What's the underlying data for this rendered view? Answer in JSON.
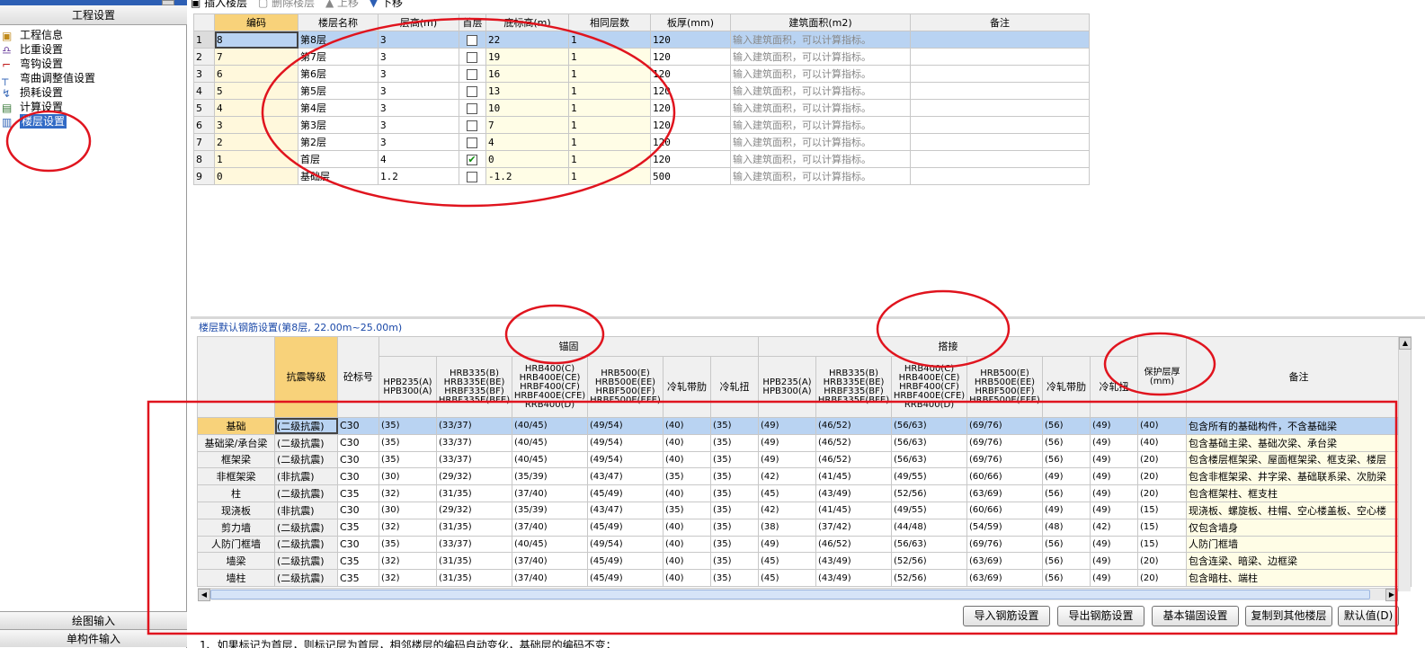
{
  "left_panel": {
    "title": "工程设置",
    "tree": [
      {
        "label": "工程信息",
        "icon": "info-icon"
      },
      {
        "label": "比重设置",
        "icon": "density-icon"
      },
      {
        "label": "弯钩设置",
        "icon": "hook-icon"
      },
      {
        "label": "弯曲调整值设置",
        "icon": "bend-icon"
      },
      {
        "label": "损耗设置",
        "icon": "loss-icon"
      },
      {
        "label": "计算设置",
        "icon": "calc-icon"
      },
      {
        "label": "楼层设置",
        "icon": "floor-icon",
        "selected": true
      }
    ],
    "bottom_buttons": [
      "绘图输入",
      "单构件输入"
    ]
  },
  "toolbar": {
    "insert_floor": "插入楼层",
    "delete_floor": "删除楼层",
    "move_up": "上移",
    "move_down": "下移"
  },
  "floor_table": {
    "headers": [
      "",
      "编码",
      "楼层名称",
      "层高(m)",
      "首层",
      "底标高(m)",
      "相同层数",
      "板厚(mm)",
      "建筑面积(m2)",
      "备注"
    ],
    "rows": [
      {
        "n": "1",
        "code": "8",
        "name": "第8层",
        "height": "3",
        "first": false,
        "elev": "22",
        "same": "1",
        "thick": "120",
        "area": "输入建筑面积，可以计算指标。",
        "note": ""
      },
      {
        "n": "2",
        "code": "7",
        "name": "第7层",
        "height": "3",
        "first": false,
        "elev": "19",
        "same": "1",
        "thick": "120",
        "area": "输入建筑面积，可以计算指标。",
        "note": ""
      },
      {
        "n": "3",
        "code": "6",
        "name": "第6层",
        "height": "3",
        "first": false,
        "elev": "16",
        "same": "1",
        "thick": "120",
        "area": "输入建筑面积，可以计算指标。",
        "note": ""
      },
      {
        "n": "4",
        "code": "5",
        "name": "第5层",
        "height": "3",
        "first": false,
        "elev": "13",
        "same": "1",
        "thick": "120",
        "area": "输入建筑面积，可以计算指标。",
        "note": ""
      },
      {
        "n": "5",
        "code": "4",
        "name": "第4层",
        "height": "3",
        "first": false,
        "elev": "10",
        "same": "1",
        "thick": "120",
        "area": "输入建筑面积，可以计算指标。",
        "note": ""
      },
      {
        "n": "6",
        "code": "3",
        "name": "第3层",
        "height": "3",
        "first": false,
        "elev": "7",
        "same": "1",
        "thick": "120",
        "area": "输入建筑面积，可以计算指标。",
        "note": ""
      },
      {
        "n": "7",
        "code": "2",
        "name": "第2层",
        "height": "3",
        "first": false,
        "elev": "4",
        "same": "1",
        "thick": "120",
        "area": "输入建筑面积，可以计算指标。",
        "note": ""
      },
      {
        "n": "8",
        "code": "1",
        "name": "首层",
        "height": "4",
        "first": true,
        "elev": "0",
        "same": "1",
        "thick": "120",
        "area": "输入建筑面积，可以计算指标。",
        "note": ""
      },
      {
        "n": "9",
        "code": "0",
        "name": "基础层",
        "height": "1.2",
        "first": false,
        "elev": "-1.2",
        "same": "1",
        "thick": "500",
        "area": "输入建筑面积，可以计算指标。",
        "note": ""
      }
    ]
  },
  "rebar": {
    "title": "楼层默认钢筋设置(第8层, 22.00m~25.00m)",
    "headers": {
      "seismic": "抗震等级",
      "concrete": "砼标号",
      "anchor_group": "锚固",
      "lap_group": "搭接",
      "cover": "保护层厚(mm)",
      "note": "备注",
      "sub": [
        "HPB235(A) HPB300(A)",
        "HRB335(B) HRB335E(BE) HRBF335(BF) HRBF335E(BFE)",
        "HRB400(C) HRB400E(CE) HRBF400(CF) HRBF400E(CFE) RRB400(D)",
        "HRB500(E) HRB500E(EE) HRBF500(EF) HRBF500E(EFE)",
        "冷轧带肋",
        "冷轧扭"
      ]
    },
    "rows": [
      {
        "name": "基础",
        "grade": "(二级抗震)",
        "c": "C30",
        "a": [
          "(35)",
          "(33/37)",
          "(40/45)",
          "(49/54)",
          "(40)",
          "(35)"
        ],
        "l": [
          "(49)",
          "(46/52)",
          "(56/63)",
          "(69/76)",
          "(56)",
          "(49)"
        ],
        "cover": "(40)",
        "note": "包含所有的基础构件，不含基础梁"
      },
      {
        "name": "基础梁/承台梁",
        "grade": "(二级抗震)",
        "c": "C30",
        "a": [
          "(35)",
          "(33/37)",
          "(40/45)",
          "(49/54)",
          "(40)",
          "(35)"
        ],
        "l": [
          "(49)",
          "(46/52)",
          "(56/63)",
          "(69/76)",
          "(56)",
          "(49)"
        ],
        "cover": "(40)",
        "note": "包含基础主梁、基础次梁、承台梁"
      },
      {
        "name": "框架梁",
        "grade": "(二级抗震)",
        "c": "C30",
        "a": [
          "(35)",
          "(33/37)",
          "(40/45)",
          "(49/54)",
          "(40)",
          "(35)"
        ],
        "l": [
          "(49)",
          "(46/52)",
          "(56/63)",
          "(69/76)",
          "(56)",
          "(49)"
        ],
        "cover": "(20)",
        "note": "包含楼层框架梁、屋面框架梁、框支梁、楼层"
      },
      {
        "name": "非框架梁",
        "grade": "(非抗震)",
        "c": "C30",
        "a": [
          "(30)",
          "(29/32)",
          "(35/39)",
          "(43/47)",
          "(35)",
          "(35)"
        ],
        "l": [
          "(42)",
          "(41/45)",
          "(49/55)",
          "(60/66)",
          "(49)",
          "(49)"
        ],
        "cover": "(20)",
        "note": "包含非框架梁、井字梁、基础联系梁、次肋梁"
      },
      {
        "name": "柱",
        "grade": "(二级抗震)",
        "c": "C35",
        "a": [
          "(32)",
          "(31/35)",
          "(37/40)",
          "(45/49)",
          "(40)",
          "(35)"
        ],
        "l": [
          "(45)",
          "(43/49)",
          "(52/56)",
          "(63/69)",
          "(56)",
          "(49)"
        ],
        "cover": "(20)",
        "note": "包含框架柱、框支柱"
      },
      {
        "name": "现浇板",
        "grade": "(非抗震)",
        "c": "C30",
        "a": [
          "(30)",
          "(29/32)",
          "(35/39)",
          "(43/47)",
          "(35)",
          "(35)"
        ],
        "l": [
          "(42)",
          "(41/45)",
          "(49/55)",
          "(60/66)",
          "(49)",
          "(49)"
        ],
        "cover": "(15)",
        "note": "现浇板、螺旋板、柱帽、空心楼盖板、空心楼"
      },
      {
        "name": "剪力墙",
        "grade": "(二级抗震)",
        "c": "C35",
        "a": [
          "(32)",
          "(31/35)",
          "(37/40)",
          "(45/49)",
          "(40)",
          "(35)"
        ],
        "l": [
          "(38)",
          "(37/42)",
          "(44/48)",
          "(54/59)",
          "(48)",
          "(42)"
        ],
        "cover": "(15)",
        "note": "仅包含墙身"
      },
      {
        "name": "人防门框墙",
        "grade": "(二级抗震)",
        "c": "C30",
        "a": [
          "(35)",
          "(33/37)",
          "(40/45)",
          "(49/54)",
          "(40)",
          "(35)"
        ],
        "l": [
          "(49)",
          "(46/52)",
          "(56/63)",
          "(69/76)",
          "(56)",
          "(49)"
        ],
        "cover": "(15)",
        "note": "人防门框墙"
      },
      {
        "name": "墙梁",
        "grade": "(二级抗震)",
        "c": "C35",
        "a": [
          "(32)",
          "(31/35)",
          "(37/40)",
          "(45/49)",
          "(40)",
          "(35)"
        ],
        "l": [
          "(45)",
          "(43/49)",
          "(52/56)",
          "(63/69)",
          "(56)",
          "(49)"
        ],
        "cover": "(20)",
        "note": "包含连梁、暗梁、边框梁"
      },
      {
        "name": "墙柱",
        "grade": "(二级抗震)",
        "c": "C35",
        "a": [
          "(32)",
          "(31/35)",
          "(37/40)",
          "(45/49)",
          "(40)",
          "(35)"
        ],
        "l": [
          "(45)",
          "(43/49)",
          "(52/56)",
          "(63/69)",
          "(56)",
          "(49)"
        ],
        "cover": "(20)",
        "note": "包含暗柱、端柱"
      }
    ]
  },
  "buttons": {
    "import": "导入钢筋设置",
    "export": "导出钢筋设置",
    "basic_anchor": "基本锚固设置",
    "copy": "复制到其他楼层",
    "default": "默认值(D)"
  },
  "bottom_note": "1、如果标记为首层，则标记层为首层，相邻楼层的编码自动变化，基础层的编码不变；",
  "colors": {
    "selection": "#b9d3f2",
    "header_highlight": "#f8d27a",
    "annotation": "#e0141e",
    "link_blue": "#1a48a8"
  }
}
